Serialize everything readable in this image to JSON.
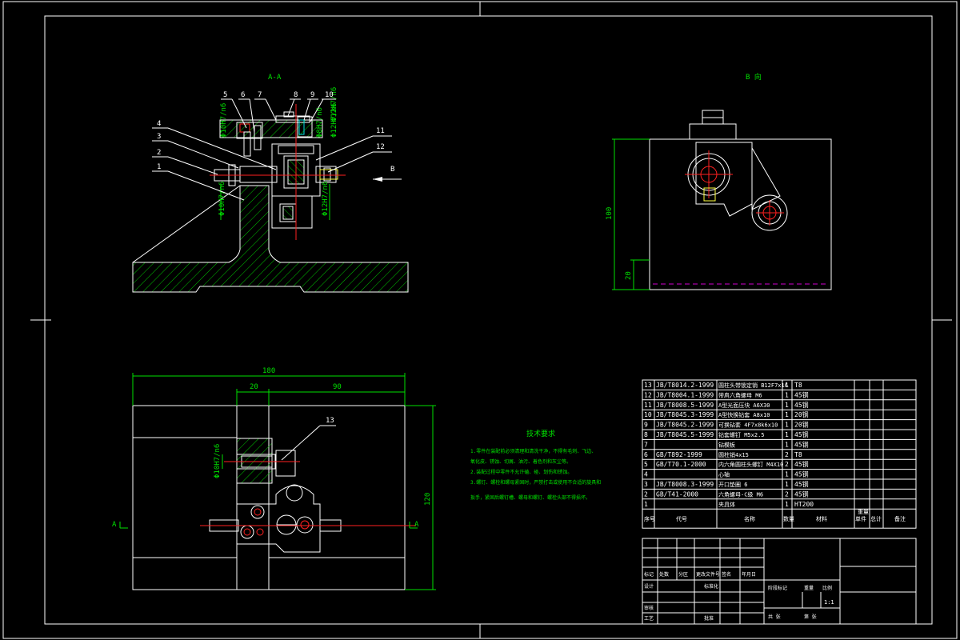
{
  "views": {
    "section_title": "A-A",
    "b_view_title": "B 向",
    "b_arrow_label": "B",
    "section_mark": "A",
    "part_callouts": [
      "1",
      "2",
      "3",
      "4",
      "5",
      "6",
      "7",
      "8",
      "9",
      "10",
      "11",
      "12",
      "13"
    ],
    "dimensions": {
      "overall_width": "180",
      "offset_left": "20",
      "offset_right": "90",
      "height_right": "120",
      "b_view_height": "100",
      "b_view_base": "20"
    },
    "fit_labels": [
      "Φ10H7/n6",
      "Φ8H7/n6",
      "Φ12H7/n6",
      "Φ12H7/k6",
      "Φ10H7/n6",
      "Φ12H7/n6"
    ]
  },
  "tech_requirements": {
    "title": "技术要求",
    "items": [
      "1.零件在装配前必须清理和清洗干净，不得有毛刺、飞边、",
      "氧化皮、锈蚀、切屑、油污、着色剂和灰尘等。",
      "2.装配过程中零件不允许磕、碰、划伤和锈蚀。",
      "3.螺钉、螺栓和螺母紧固时，严禁打击或使用不合适的旋具和",
      "扳手，紧固后螺钉槽、螺母和螺钉、螺栓头部不得损坏。"
    ]
  },
  "bom": {
    "rows": [
      {
        "no": "13",
        "code": "JB/T8014.2-1999",
        "name": "圆柱头带锁定销 B12F7x16",
        "qty": "1",
        "mat": "T8"
      },
      {
        "no": "12",
        "code": "JB/T8004.1-1999",
        "name": "带肩六角螺母 M6",
        "qty": "1",
        "mat": "45钢"
      },
      {
        "no": "11",
        "code": "JB/T8008.5-1999",
        "name": "A型光面压块 A6X30",
        "qty": "1",
        "mat": "45钢"
      },
      {
        "no": "10",
        "code": "JB/T8045.3-1999",
        "name": "A型快换钻套 A8x10",
        "qty": "1",
        "mat": "20钢"
      },
      {
        "no": "9",
        "code": "JB/T8045.2-1999",
        "name": "可换钻套 4F7x8k6x10",
        "qty": "1",
        "mat": "20钢"
      },
      {
        "no": "8",
        "code": "JB/T8045.5-1999",
        "name": "钻套螺钉 M5x2.5",
        "qty": "1",
        "mat": "45钢"
      },
      {
        "no": "7",
        "code": "",
        "name": "钻模板",
        "qty": "1",
        "mat": "45钢"
      },
      {
        "no": "6",
        "code": "GB/T892-1999",
        "name": "圆柱销4x15",
        "qty": "2",
        "mat": "T8"
      },
      {
        "no": "5",
        "code": "GB/T70.1-2000",
        "name": "内六角圆柱头螺钉 M4X10",
        "qty": "2",
        "mat": "45钢"
      },
      {
        "no": "4",
        "code": "",
        "name": "心轴",
        "qty": "1",
        "mat": "45钢"
      },
      {
        "no": "3",
        "code": "JB/T8008.3-1999",
        "name": "开口垫圈 6",
        "qty": "1",
        "mat": "45钢"
      },
      {
        "no": "2",
        "code": "GB/T41-2000",
        "name": "六角螺母-C级 M6",
        "qty": "2",
        "mat": "45钢"
      },
      {
        "no": "1",
        "code": "",
        "name": "夹具体",
        "qty": "1",
        "mat": "HT200"
      }
    ],
    "header": {
      "no": "序号",
      "code": "代号",
      "name": "名称",
      "qty": "数量",
      "mat": "材料",
      "unit": "单件",
      "total": "总计",
      "weight": "重量",
      "remark": "备注"
    }
  },
  "title_block": {
    "mark": "标记",
    "count": "处数",
    "zone": "分区",
    "change_doc": "更改文件号",
    "sign": "签名",
    "date": "年月日",
    "designer": "设计",
    "standard": "标准化",
    "stage": "阶段标记",
    "weight": "重量",
    "scale": "比例",
    "scale_value": "1:1",
    "checker": "审核",
    "process": "工艺",
    "approve": "批准",
    "sheet_total": "共 张",
    "sheet_no": "第 张"
  }
}
